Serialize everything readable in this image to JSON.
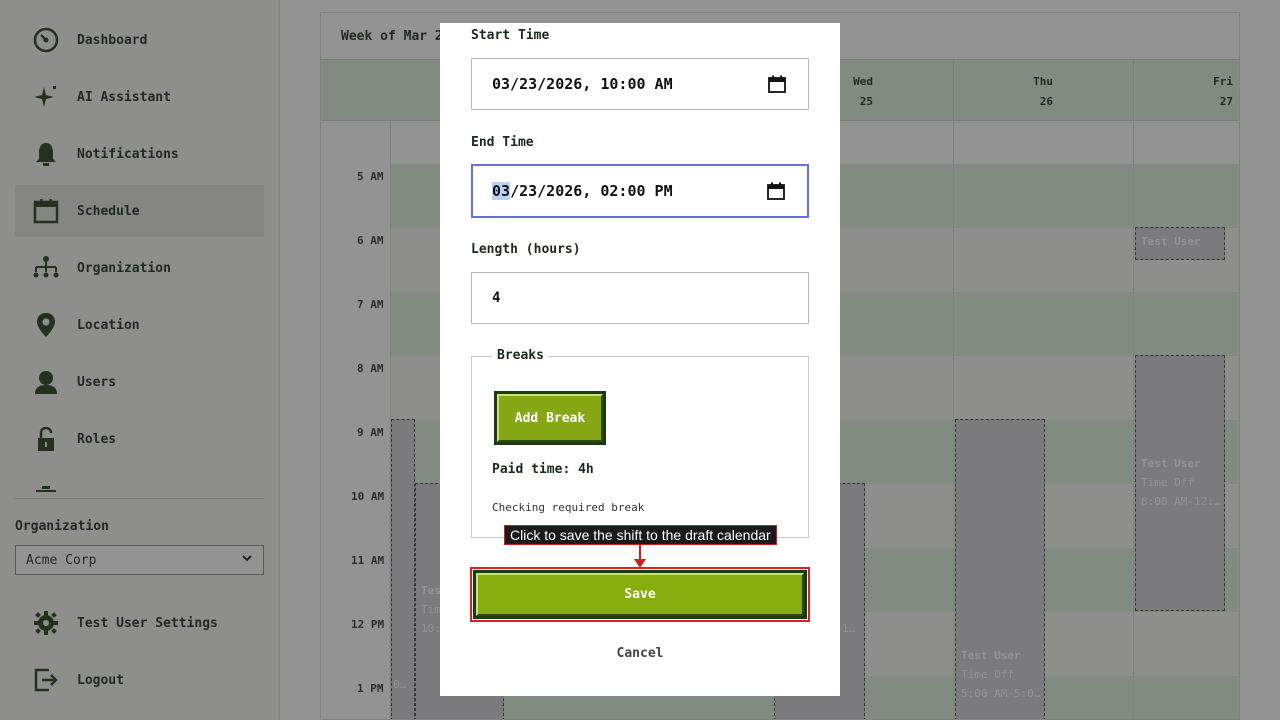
{
  "sidebar": {
    "items": [
      {
        "label": "Dashboard",
        "icon": "dashboard-icon"
      },
      {
        "label": "AI Assistant",
        "icon": "sparkle-icon"
      },
      {
        "label": "Notifications",
        "icon": "bell-icon"
      },
      {
        "label": "Schedule",
        "icon": "calendar-icon",
        "active": true
      },
      {
        "label": "Organization",
        "icon": "org-chart-icon"
      },
      {
        "label": "Location",
        "icon": "location-pin-icon"
      },
      {
        "label": "Users",
        "icon": "user-icon"
      },
      {
        "label": "Roles",
        "icon": "lock-icon"
      }
    ],
    "org_label": "Organization",
    "org_value": "Acme Corp",
    "settings_label": "Test User Settings",
    "logout_label": "Logout"
  },
  "calendar": {
    "week_title": "Week of Mar 22",
    "days": [
      {
        "name": "Wed",
        "date": "25"
      },
      {
        "name": "Thu",
        "date": "26"
      },
      {
        "name": "Fri",
        "date": "27"
      }
    ],
    "time_labels": [
      "5 AM",
      "6 AM",
      "7 AM",
      "8 AM",
      "9 AM",
      "10 AM",
      "11 AM",
      "12 PM",
      "1 PM"
    ],
    "events": [
      {
        "title": "Test User",
        "sub1": "",
        "sub2": ""
      },
      {
        "title": "Test User",
        "sub1": "Time Off",
        "sub2": "8:00 AM-12:…"
      },
      {
        "title": "Test User",
        "sub1": "Time Off",
        "sub2": "5:00 AM-5:0…"
      },
      {
        "title": "Tes",
        "sub1": "Tim",
        "sub2": "10:"
      },
      {
        "title": "",
        "sub1": "",
        "sub2": "1…"
      },
      {
        "title": "",
        "sub1": "",
        "sub2": "0…"
      }
    ]
  },
  "modal": {
    "start_label": "Start Time",
    "start_value_pre": "",
    "start_value": "03/23/2026, 10:00 AM",
    "end_label": "End Time",
    "end_value_sel": "03",
    "end_value_rest": "/23/2026, 02:00 PM",
    "length_label": "Length (hours)",
    "length_value": "4",
    "breaks_legend": "Breaks",
    "add_break_label": "Add Break",
    "paid_time": "Paid time: 4h",
    "checking_text": "Checking required break",
    "save_label": "Save",
    "cancel_label": "Cancel"
  },
  "tooltip": {
    "text": "Click to save the shift to the draft calendar"
  },
  "colors": {
    "brand_green": "#88ae0e",
    "dark_green": "#1e3a12",
    "focus_border": "#6670d8",
    "highlight_red": "#d41c1c",
    "calendar_green": "#d9f1d9"
  }
}
